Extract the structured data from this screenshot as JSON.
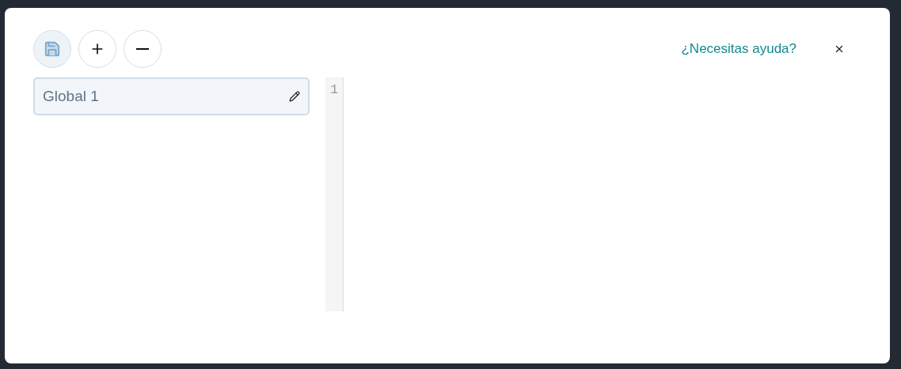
{
  "toolbar": {
    "buttons": [
      {
        "kind": "save",
        "disabled": true
      },
      {
        "kind": "add",
        "disabled": false
      },
      {
        "kind": "remove",
        "disabled": false
      }
    ]
  },
  "help_link": "¿Necesitas ayuda?",
  "sidebar": {
    "items": [
      {
        "label": "Global 1",
        "selected": true
      }
    ]
  },
  "editor": {
    "line_numbers": [
      "1"
    ]
  }
}
